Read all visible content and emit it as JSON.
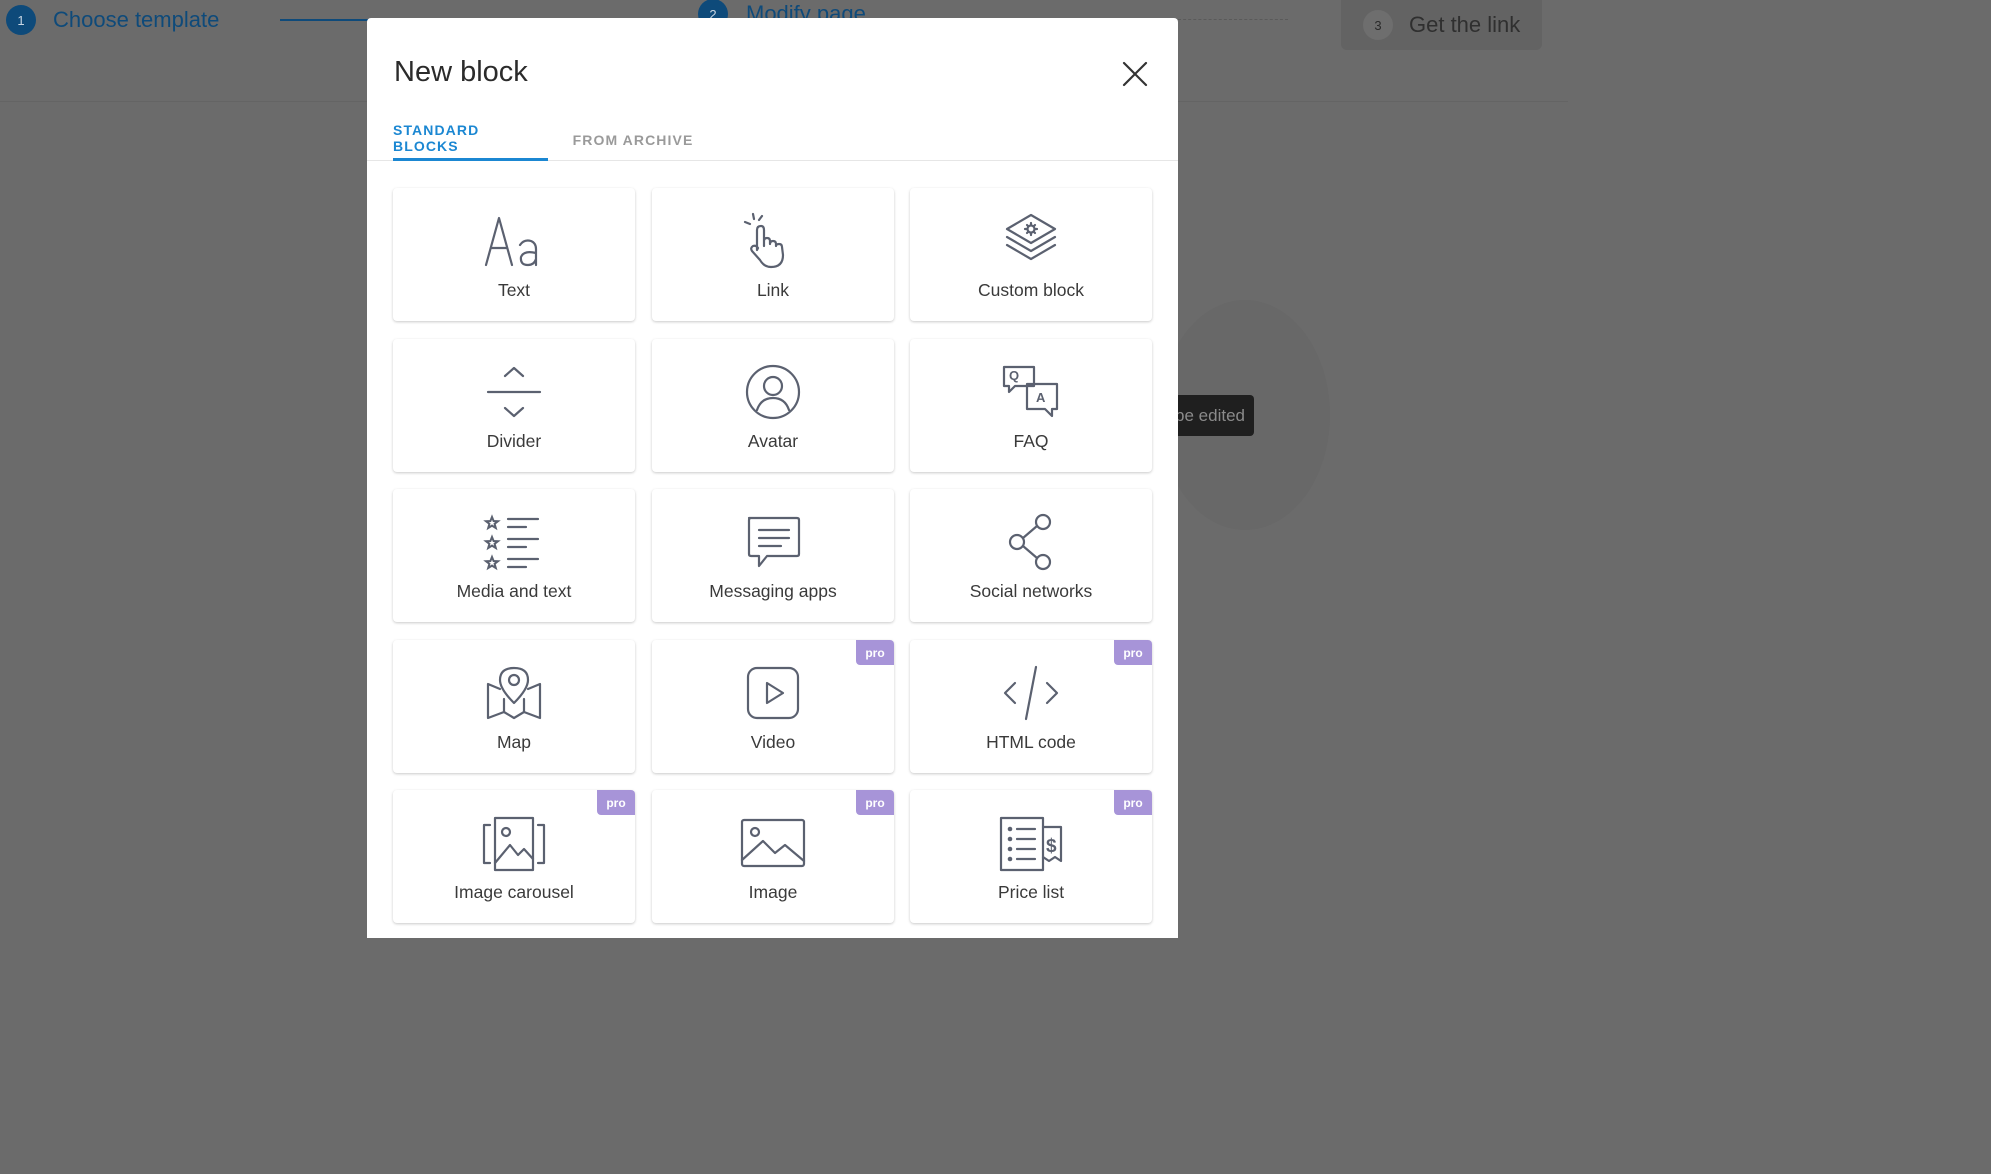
{
  "background": {
    "steps": [
      {
        "num": "1",
        "label": "Choose template"
      },
      {
        "num": "2",
        "label": "Modify page"
      },
      {
        "num": "3",
        "label": "Get the link"
      }
    ],
    "tooltip": "be edited"
  },
  "modal": {
    "title": "New block",
    "tabs": [
      {
        "label": "STANDARD BLOCKS",
        "active": true
      },
      {
        "label": "FROM ARCHIVE",
        "active": false
      }
    ],
    "pro_badge": "pro",
    "blocks": [
      {
        "label": "Text",
        "icon": "text-icon",
        "pro": false
      },
      {
        "label": "Link",
        "icon": "pointer-hand-icon",
        "pro": false
      },
      {
        "label": "Custom block",
        "icon": "layers-gear-icon",
        "pro": false
      },
      {
        "label": "Divider",
        "icon": "divider-icon",
        "pro": false
      },
      {
        "label": "Avatar",
        "icon": "avatar-icon",
        "pro": false
      },
      {
        "label": "FAQ",
        "icon": "faq-icon",
        "pro": false
      },
      {
        "label": "Media and text",
        "icon": "media-list-icon",
        "pro": false
      },
      {
        "label": "Messaging apps",
        "icon": "chat-bubble-icon",
        "pro": false
      },
      {
        "label": "Social networks",
        "icon": "share-icon",
        "pro": false
      },
      {
        "label": "Map",
        "icon": "map-pin-icon",
        "pro": false
      },
      {
        "label": "Video",
        "icon": "play-icon",
        "pro": true
      },
      {
        "label": "HTML code",
        "icon": "code-icon",
        "pro": true
      },
      {
        "label": "Image carousel",
        "icon": "carousel-icon",
        "pro": true
      },
      {
        "label": "Image",
        "icon": "image-icon",
        "pro": true
      },
      {
        "label": "Price list",
        "icon": "price-list-icon",
        "pro": true
      }
    ]
  }
}
